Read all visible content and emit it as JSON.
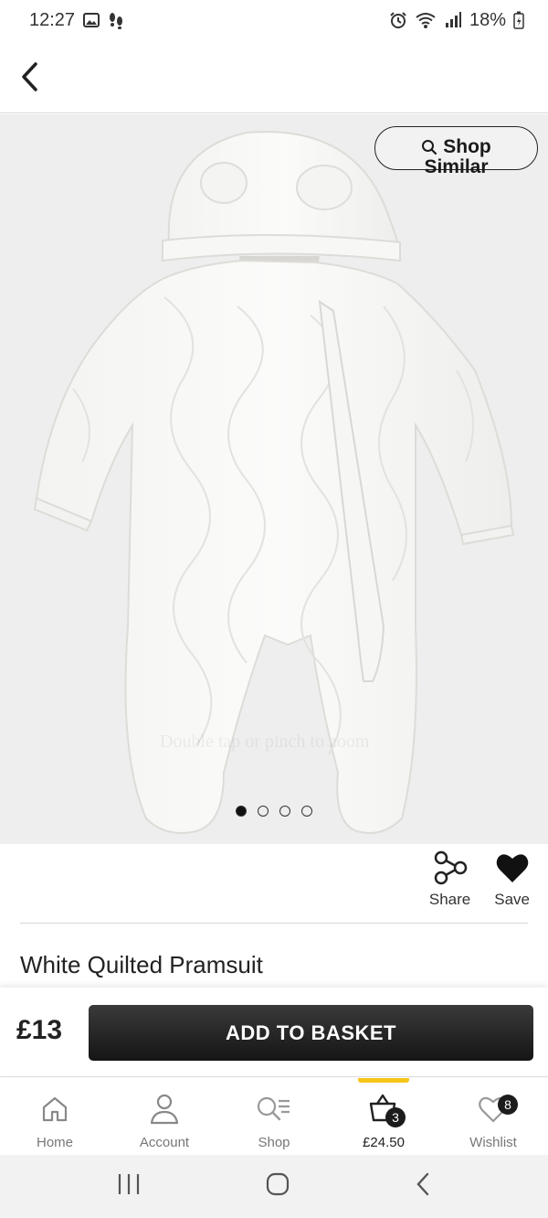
{
  "status_bar": {
    "time": "12:27",
    "battery": "18%"
  },
  "shop_similar": {
    "line1": "Shop",
    "line2": "Similar"
  },
  "image": {
    "zoom_hint": "Double tap or pinch to zoom",
    "dots_total": 4,
    "dots_active": 1
  },
  "actions": {
    "share_label": "Share",
    "save_label": "Save"
  },
  "product": {
    "title": "White Quilted Pramsuit",
    "price": "£13"
  },
  "basket": {
    "add_label": "ADD TO BASKET"
  },
  "bottom_nav": {
    "home": "Home",
    "account": "Account",
    "shop": "Shop",
    "basket_total": "£24.50",
    "basket_count": "3",
    "wishlist": "Wishlist",
    "wishlist_count": "8"
  },
  "colors": {
    "accent": "#f5c518",
    "button": "#1f1f1f"
  }
}
